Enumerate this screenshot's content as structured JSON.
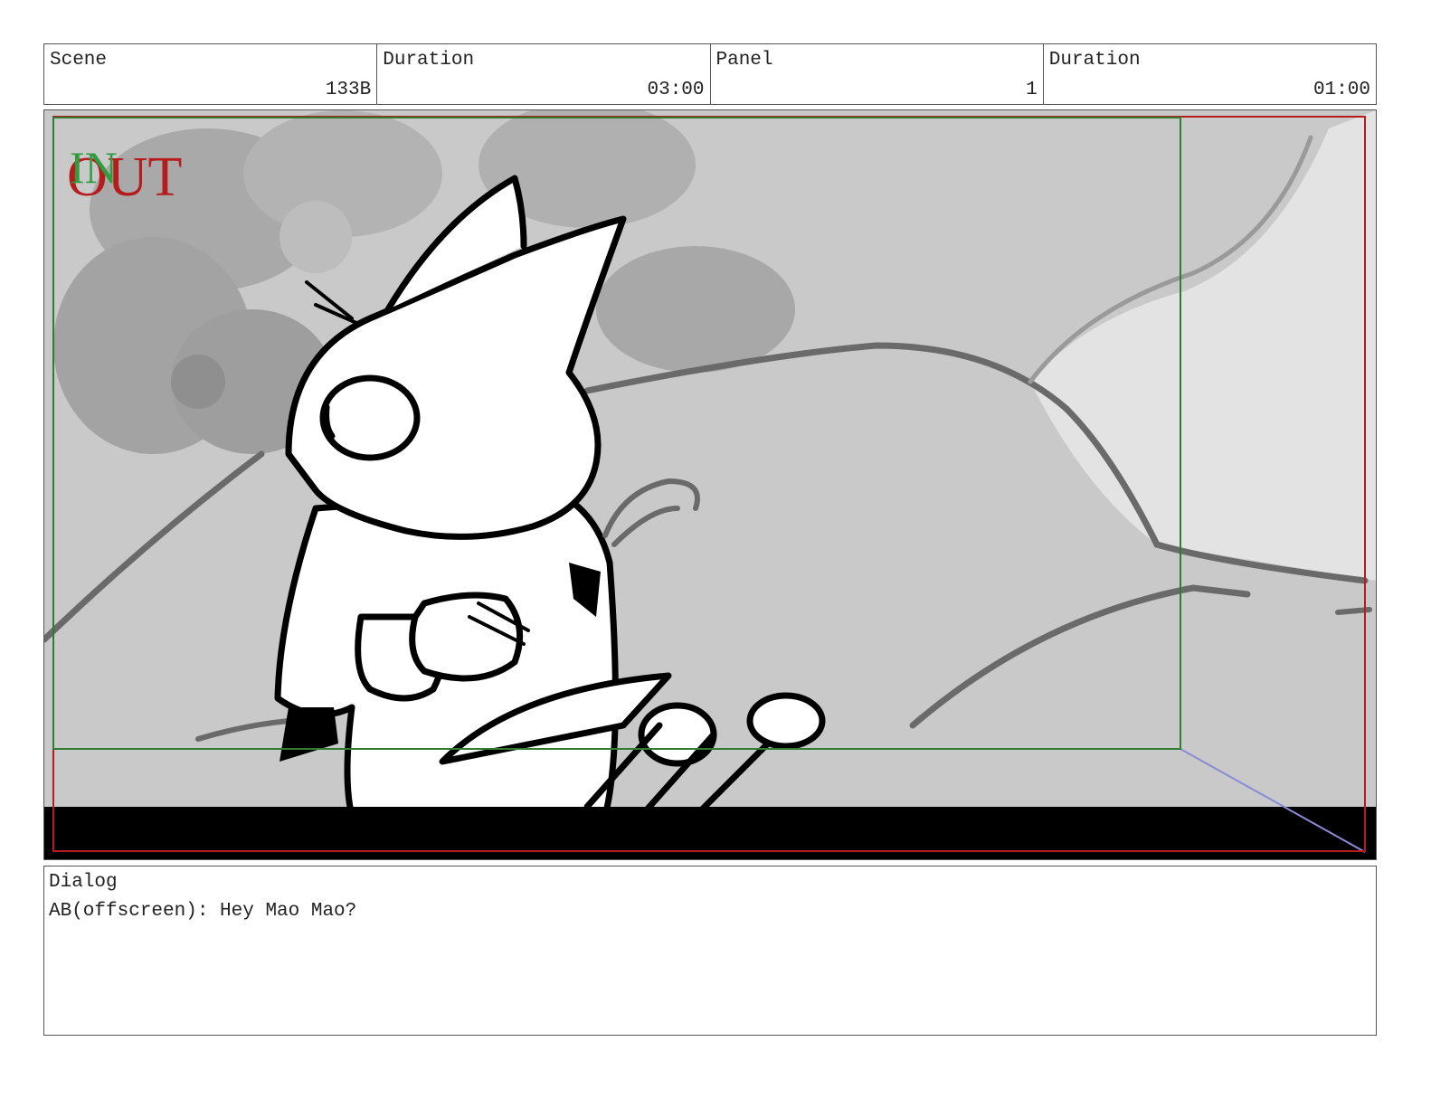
{
  "header": {
    "scene_label": "Scene",
    "scene_value": "133B",
    "scene_duration_label": "Duration",
    "scene_duration_value": "03:00",
    "panel_label": "Panel",
    "panel_value": "1",
    "panel_duration_label": "Duration",
    "panel_duration_value": "01:00"
  },
  "panel": {
    "in_marker": "IN",
    "out_marker": "OUT",
    "colors": {
      "in_frame": "#2e7d32",
      "out_frame": "#b71c1c",
      "background": "#c9c9c9",
      "letterbox": "#000000"
    }
  },
  "dialog": {
    "label": "Dialog",
    "text": "AB(offscreen): Hey Mao Mao?"
  }
}
